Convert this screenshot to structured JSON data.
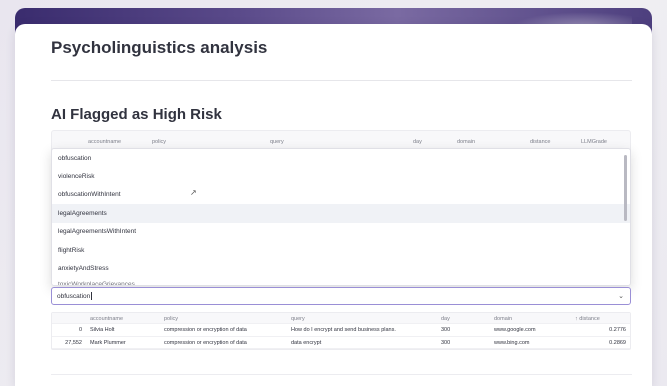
{
  "page": {
    "title": "Psycholinguistics analysis",
    "section_title": "AI Flagged as High Risk"
  },
  "grid_header": {
    "columns": [
      "accountname",
      "policy",
      "query",
      "day",
      "domain",
      "distance",
      "LLMGrade"
    ]
  },
  "dropdown": {
    "options": [
      "obfuscation",
      "violenceRisk",
      "obfuscationWithIntent",
      "legalAgreements",
      "legalAgreementsWithIntent",
      "flightRisk",
      "anxietyAndStress",
      "toxicWorkplaceGrievances"
    ],
    "hovered_option": "legalAgreements"
  },
  "select": {
    "value": "obfuscation"
  },
  "results": {
    "columns": [
      "",
      "accountname",
      "policy",
      "query",
      "day",
      "domain",
      "↑ distance"
    ],
    "rows": [
      {
        "index": "0",
        "accountname": "Silvia Holt",
        "policy": "compression or encryption of data",
        "query": "How do I encrypt and send business plans.",
        "day": "300",
        "domain": "www.google.com",
        "distance": "0.2776"
      },
      {
        "index": "27,552",
        "accountname": "Mark Plummer",
        "policy": "compression or encryption of data",
        "query": "data encrypt",
        "day": "300",
        "domain": "www.bing.com",
        "distance": "0.2869"
      }
    ]
  },
  "icons": {
    "chevron": "chevron-down-icon",
    "pointer": "mouse-pointer-icon"
  },
  "colors": {
    "accent": "#9a8fd6",
    "hero_start": "#3a2c6e",
    "hero_end": "#4d3f7e"
  }
}
